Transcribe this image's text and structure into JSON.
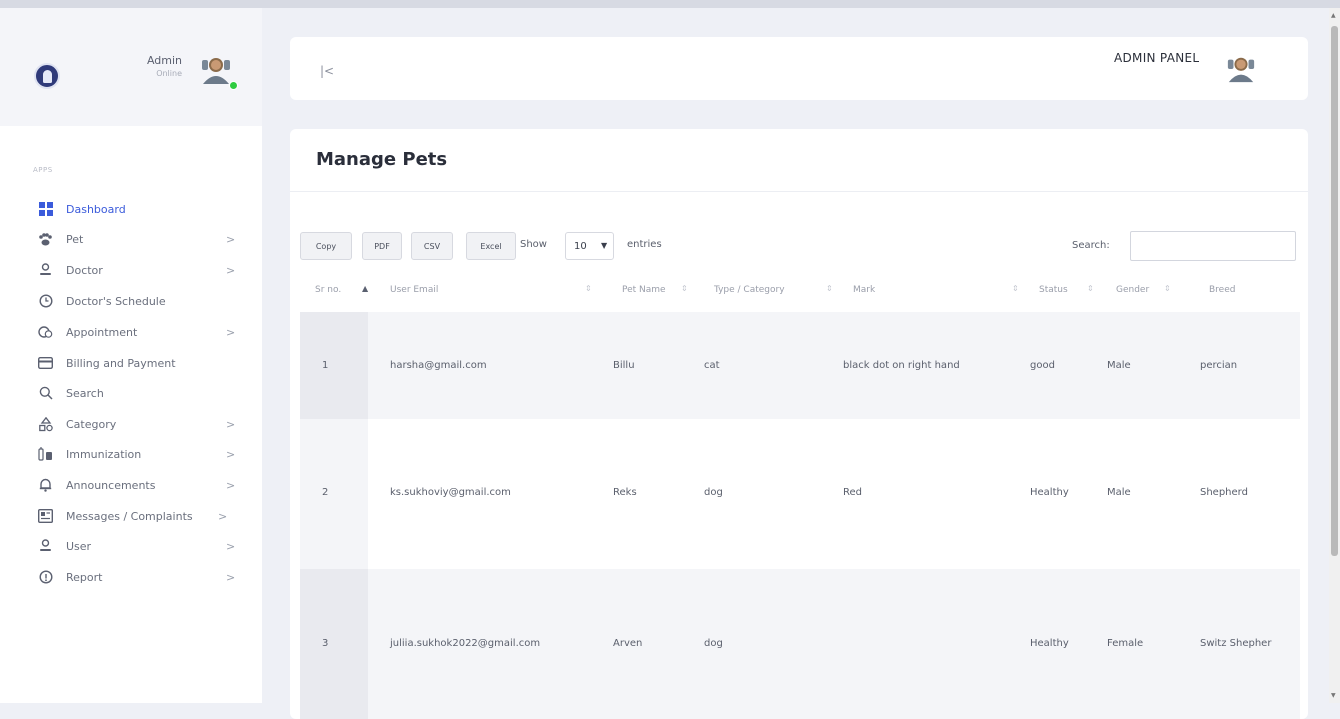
{
  "sidebar": {
    "user_name": "Admin",
    "user_status": "Online",
    "section_label": "APPS",
    "items": [
      {
        "label": "Dashboard",
        "icon": "dashboard-icon"
      },
      {
        "label": "Pet",
        "icon": "pet-icon"
      },
      {
        "label": "Doctor",
        "icon": "user-icon"
      },
      {
        "label": "Doctor's Schedule",
        "icon": "clock-icon"
      },
      {
        "label": "Appointment",
        "icon": "appointment-icon"
      },
      {
        "label": "Billing and Payment",
        "icon": "card-icon"
      },
      {
        "label": "Search",
        "icon": "search-icon"
      },
      {
        "label": "Category",
        "icon": "category-icon"
      },
      {
        "label": "Immunization",
        "icon": "vaccine-icon"
      },
      {
        "label": "Announcements",
        "icon": "bell-icon"
      },
      {
        "label": "Messages / Complaints",
        "icon": "messages-icon"
      },
      {
        "label": "User",
        "icon": "user-icon"
      },
      {
        "label": "Report",
        "icon": "report-icon"
      }
    ],
    "chevron": ">"
  },
  "header": {
    "collapse_icon": "|<",
    "title": "ADMIN PANEL"
  },
  "main": {
    "page_title": "Manage Pets",
    "buttons": {
      "copy": "Copy",
      "pdf": "PDF",
      "csv": "CSV",
      "excel": "Excel"
    },
    "show_label": "Show",
    "page_size": "10",
    "entries_label": "entries",
    "search_label": "Search:",
    "search_value": "",
    "sort_indicator": "⇕",
    "sort_active_indicator": "▲",
    "columns": [
      "Sr no.",
      "User Email",
      "Pet Name",
      "Type / Category",
      "Mark",
      "Status",
      "Gender",
      "Breed"
    ],
    "rows": [
      [
        "1",
        "harsha@gmail.com",
        "Billu",
        "cat",
        "black dot on right hand",
        "good",
        "Male",
        "percian"
      ],
      [
        "2",
        "ks.sukhoviy@gmail.com",
        "Reks",
        "dog",
        "Red",
        "Healthy",
        "Male",
        "Shepherd"
      ],
      [
        "3",
        "juliia.sukhok2022@gmail.com",
        "Arven",
        "dog",
        "",
        "Healthy",
        "Female",
        "Switz Shepher"
      ]
    ]
  },
  "colors": {
    "accent": "#3b5bdb",
    "online": "#2ecc40",
    "background": "#eef0f6"
  }
}
